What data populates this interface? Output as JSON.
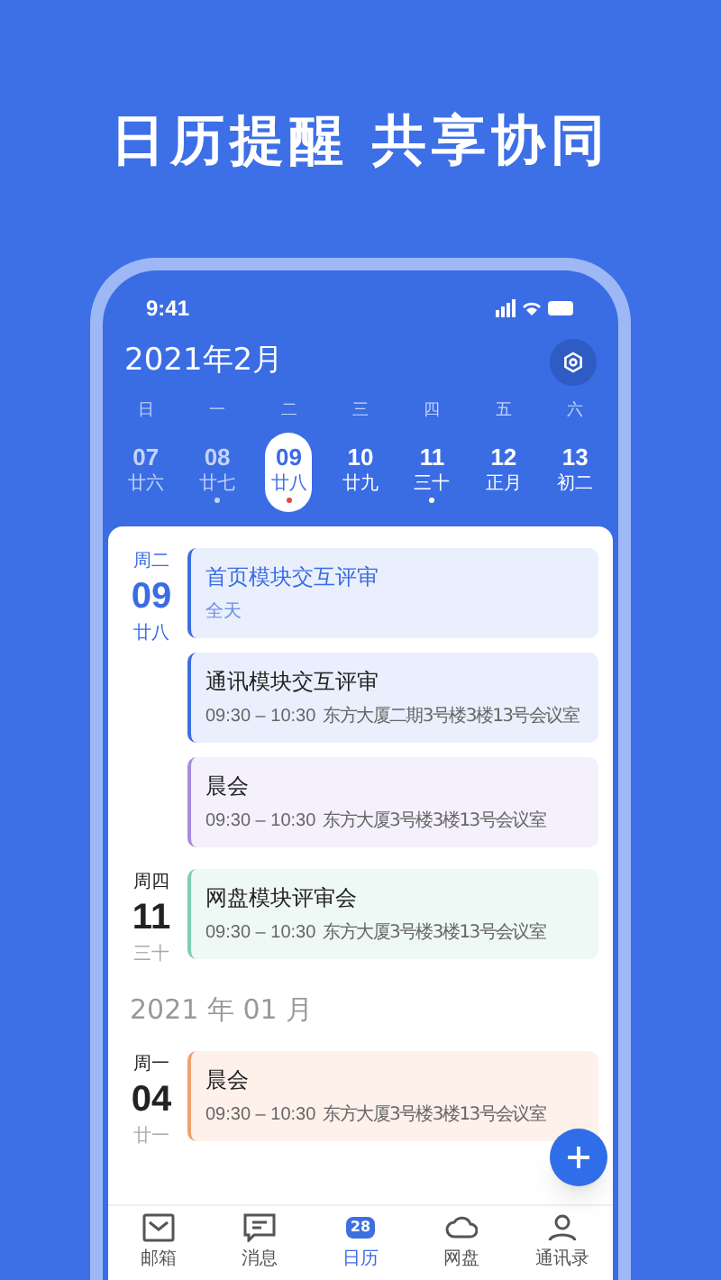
{
  "headline": "日历提醒 共享协同",
  "status_bar": {
    "time": "9:41"
  },
  "calendar": {
    "month_title": "2021年2月",
    "weekdays": [
      "日",
      "一",
      "二",
      "三",
      "四",
      "五",
      "六"
    ],
    "days": [
      {
        "date": "07",
        "lunar": "廿六",
        "selected": false,
        "has_event": false,
        "past": true
      },
      {
        "date": "08",
        "lunar": "廿七",
        "selected": false,
        "has_event": true,
        "past": true
      },
      {
        "date": "09",
        "lunar": "廿八",
        "selected": true,
        "has_event": true,
        "past": false
      },
      {
        "date": "10",
        "lunar": "廿九",
        "selected": false,
        "has_event": false,
        "past": false
      },
      {
        "date": "11",
        "lunar": "三十",
        "selected": false,
        "has_event": true,
        "past": false
      },
      {
        "date": "12",
        "lunar": "正月",
        "selected": false,
        "has_event": false,
        "past": false
      },
      {
        "date": "13",
        "lunar": "初二",
        "selected": false,
        "has_event": false,
        "past": false
      }
    ]
  },
  "agenda": [
    {
      "kind": "day",
      "weekday": "周二",
      "date": "09",
      "lunar": "廿八",
      "selected": true,
      "events": [
        {
          "title": "首页模块交互评审",
          "time": "全天",
          "selected": true,
          "color": "#3d6fe0"
        },
        {
          "title": "通讯模块交互评审",
          "time": "09:30 – 10:30",
          "location": "东方大厦二期3号楼3楼13号会议室",
          "selected": false,
          "color": "#3d6fe0"
        },
        {
          "title": "晨会",
          "time": "09:30 – 10:30",
          "location": "东方大厦3号楼3楼13号会议室",
          "selected": false,
          "color": "#a78bdc"
        }
      ]
    },
    {
      "kind": "day",
      "weekday": "周四",
      "date": "11",
      "lunar": "三十",
      "selected": false,
      "events": [
        {
          "title": "网盘模块评审会",
          "time": "09:30 – 10:30",
          "location": "东方大厦3号楼3楼13号会议室",
          "selected": false,
          "color": "#7fd0b0"
        }
      ]
    },
    {
      "kind": "month",
      "title": "2021 年 01 月"
    },
    {
      "kind": "day",
      "weekday": "周一",
      "date": "04",
      "lunar": "廿一",
      "selected": false,
      "events": [
        {
          "title": "晨会",
          "time": "09:30 – 10:30",
          "location": "东方大厦3号楼3楼13号会议室",
          "selected": false,
          "color": "#f0a070"
        }
      ]
    }
  ],
  "tab_bar": [
    {
      "label": "邮箱",
      "kind": "mail",
      "selected": false
    },
    {
      "label": "消息",
      "kind": "message",
      "selected": false
    },
    {
      "label": "日历",
      "kind": "calendar",
      "badge": "28",
      "selected": true
    },
    {
      "label": "网盘",
      "kind": "disk",
      "selected": false
    },
    {
      "label": "通讯录",
      "kind": "contacts",
      "selected": false
    }
  ]
}
